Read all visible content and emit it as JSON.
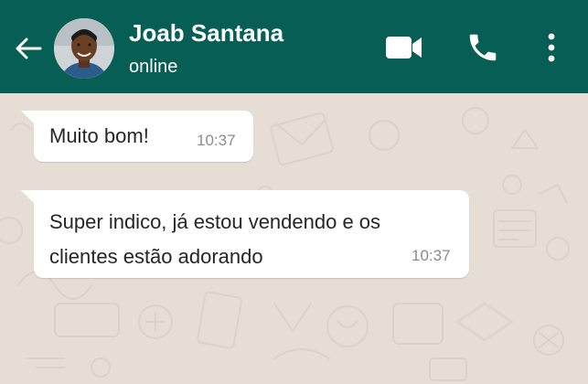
{
  "header": {
    "contact_name": "Joab Santana",
    "status": "online",
    "background_color": "#075e54",
    "icons": {
      "back": "arrow-left-icon",
      "video": "video-camera-icon",
      "call": "phone-icon",
      "menu": "more-vertical-icon"
    }
  },
  "messages": [
    {
      "direction": "incoming",
      "text": "Muito bom!",
      "time": "10:37"
    },
    {
      "direction": "incoming",
      "text": "Super indico, já estou vendendo e os clientes estão adorando",
      "time": "10:37"
    }
  ],
  "chat": {
    "background_color": "#e6ded5",
    "bubble_color": "#ffffff"
  }
}
